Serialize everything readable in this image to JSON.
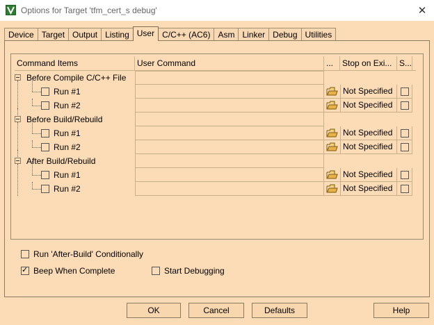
{
  "window": {
    "title": "Options for Target 'tfm_cert_s debug'",
    "close_glyph": "✕"
  },
  "tabs": [
    {
      "label": "Device"
    },
    {
      "label": "Target"
    },
    {
      "label": "Output"
    },
    {
      "label": "Listing"
    },
    {
      "label": "User",
      "active": true
    },
    {
      "label": "C/C++ (AC6)"
    },
    {
      "label": "Asm"
    },
    {
      "label": "Linker"
    },
    {
      "label": "Debug"
    },
    {
      "label": "Utilities"
    }
  ],
  "grid": {
    "headers": {
      "command_items": "Command Items",
      "user_command": "User Command",
      "browse": "...",
      "stop_on_exit": "Stop on Exi...",
      "s": "S..."
    },
    "groups": [
      {
        "label": "Before Compile C/C++ File",
        "items": [
          {
            "label": "Run #1",
            "checked": false,
            "command": "",
            "stop": "Not Specified",
            "s_checked": false
          },
          {
            "label": "Run #2",
            "checked": false,
            "command": "",
            "stop": "Not Specified",
            "s_checked": false
          }
        ]
      },
      {
        "label": "Before Build/Rebuild",
        "items": [
          {
            "label": "Run #1",
            "checked": false,
            "command": "",
            "stop": "Not Specified",
            "s_checked": false
          },
          {
            "label": "Run #2",
            "checked": false,
            "command": "",
            "stop": "Not Specified",
            "s_checked": false
          }
        ]
      },
      {
        "label": "After Build/Rebuild",
        "items": [
          {
            "label": "Run #1",
            "checked": false,
            "command": "",
            "stop": "Not Specified",
            "s_checked": false
          },
          {
            "label": "Run #2",
            "checked": false,
            "command": "",
            "stop": "Not Specified",
            "s_checked": false
          }
        ]
      }
    ]
  },
  "options": {
    "run_after_build": {
      "label": "Run 'After-Build' Conditionally",
      "checked": false
    },
    "beep_when_complete": {
      "label": "Beep When Complete",
      "checked": true
    },
    "start_debugging": {
      "label": "Start Debugging",
      "checked": false
    }
  },
  "buttons": {
    "ok": "OK",
    "cancel": "Cancel",
    "defaults": "Defaults",
    "help": "Help"
  }
}
